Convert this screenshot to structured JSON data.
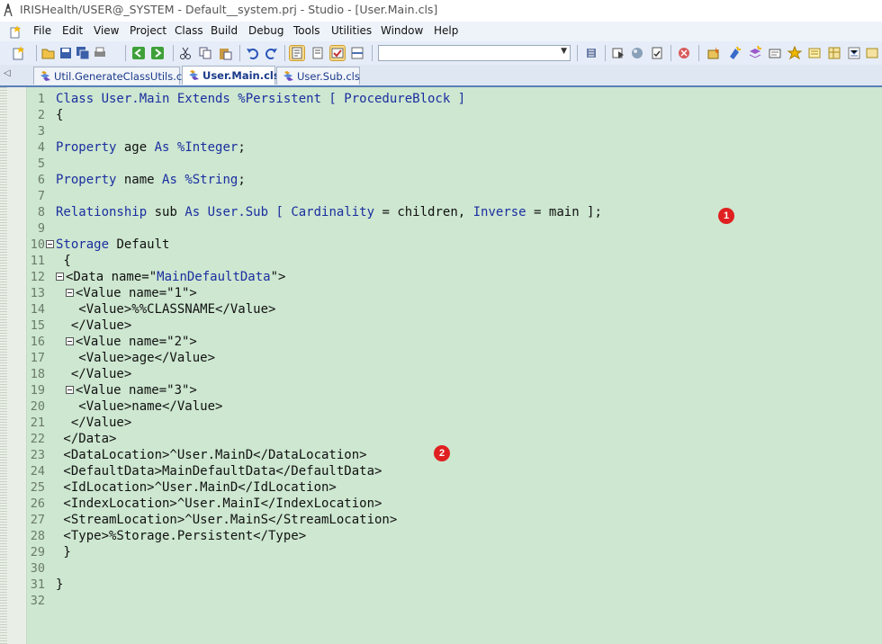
{
  "window": {
    "title": "IRISHealth/USER@_SYSTEM - Default__system.prj - Studio - [User.Main.cls]"
  },
  "menu": [
    "File",
    "Edit",
    "View",
    "Project",
    "Class",
    "Build",
    "Debug",
    "Tools",
    "Utilities",
    "Window",
    "Help"
  ],
  "toolbar": {
    "combo_value": "",
    "icons": [
      "new-file-icon",
      "open-icon",
      "save-icon",
      "save-all-icon",
      "print-icon",
      "back-icon",
      "forward-icon",
      "cut-icon",
      "copy-icon",
      "paste-icon",
      "undo-icon",
      "redo-icon",
      "view-code-icon",
      "view-other-icon",
      "class-inspector-icon",
      "split-view-icon",
      "compile-icon",
      "debug-icon",
      "run-icon",
      "check-icon",
      "stop-icon",
      "wizard-icon",
      "method-icon",
      "property-icon",
      "index-icon",
      "query-icon",
      "trigger-icon",
      "storage-icon",
      "xdata-icon"
    ]
  },
  "tabs": [
    {
      "label": "Util.GenerateClassUtils.cls",
      "active": false
    },
    {
      "label": "User.Main.cls",
      "active": true
    },
    {
      "label": "User.Sub.cls",
      "active": false
    }
  ],
  "editor": {
    "lines": [
      {
        "n": "1",
        "text": ""
      },
      {
        "n": "2",
        "text": "{"
      },
      {
        "n": "3",
        "text": ""
      },
      {
        "n": "4",
        "text": ""
      },
      {
        "n": "5",
        "text": ""
      },
      {
        "n": "6",
        "text": ""
      },
      {
        "n": "7",
        "text": ""
      },
      {
        "n": "8",
        "text": ""
      },
      {
        "n": "9",
        "text": ""
      },
      {
        "n": "10",
        "text": ""
      },
      {
        "n": "11",
        "text": " {"
      },
      {
        "n": "12",
        "text": ""
      },
      {
        "n": "13",
        "text": ""
      },
      {
        "n": "14",
        "text": "   <Value>%%CLASSNAME</Value>"
      },
      {
        "n": "15",
        "text": "  </Value>"
      },
      {
        "n": "16",
        "text": ""
      },
      {
        "n": "17",
        "text": "   <Value>age</Value>"
      },
      {
        "n": "18",
        "text": "  </Value>"
      },
      {
        "n": "19",
        "text": ""
      },
      {
        "n": "20",
        "text": "   <Value>name</Value>"
      },
      {
        "n": "21",
        "text": "  </Value>"
      },
      {
        "n": "22",
        "text": " </Data>"
      },
      {
        "n": "23",
        "text": " <DataLocation>^User.MainD</DataLocation>"
      },
      {
        "n": "24",
        "text": " <DefaultData>MainDefaultData</DefaultData>"
      },
      {
        "n": "25",
        "text": " <IdLocation>^User.MainD</IdLocation>"
      },
      {
        "n": "26",
        "text": " <IndexLocation>^User.MainI</IndexLocation>"
      },
      {
        "n": "27",
        "text": " <StreamLocation>^User.MainS</StreamLocation>"
      },
      {
        "n": "28",
        "text": " <Type>%Storage.Persistent</Type>"
      },
      {
        "n": "29",
        "text": " }"
      },
      {
        "n": "30",
        "text": ""
      },
      {
        "n": "31",
        "text": "}"
      },
      {
        "n": "32",
        "text": ""
      }
    ],
    "tokens": {
      "l1": {
        "a": "Class User.Main Extends %Persistent [ ProcedureBlock ]"
      },
      "l4": {
        "a": "Property",
        "b": " age ",
        "c": "As",
        "d": " ",
        "e": "%Integer",
        "f": ";"
      },
      "l6": {
        "a": "Property",
        "b": " name ",
        "c": "As",
        "d": " ",
        "e": "%String",
        "f": ";"
      },
      "l8": {
        "a": "Relationship",
        "b": " sub ",
        "c": "As User.Sub [ Cardinality",
        "d": " = children, ",
        "e": "Inverse",
        "f": " = main ];"
      },
      "l10": {
        "a": "Storage",
        "b": " Default"
      },
      "l12": {
        "a": "<Data name=\"",
        "b": "MainDefaultData",
        "c": "\">"
      },
      "l13": {
        "a": "<Value name=\"1\">"
      },
      "l16": {
        "a": "<Value name=\"2\">"
      },
      "l19": {
        "a": "<Value name=\"3\">"
      }
    },
    "badges": [
      "1",
      "2"
    ]
  },
  "colors": {
    "editor_bg": "#cde7d0",
    "keyword": "#1b2ea0",
    "badge": "#e02020"
  }
}
